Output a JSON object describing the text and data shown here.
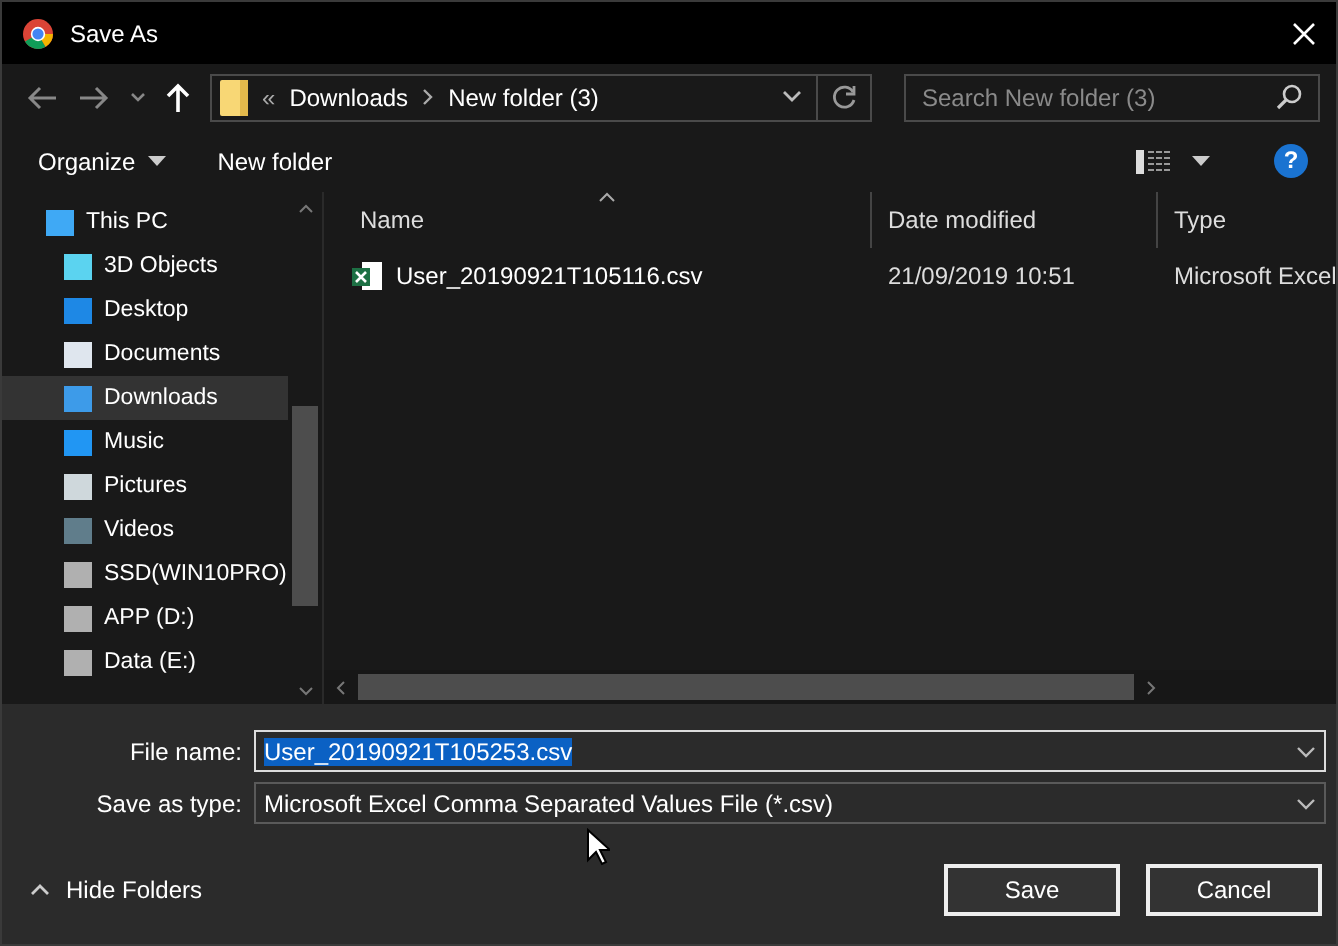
{
  "window": {
    "title": "Save As"
  },
  "address": {
    "overflow": "«",
    "segments": [
      "Downloads",
      "New folder (3)"
    ]
  },
  "search": {
    "placeholder": "Search New folder (3)"
  },
  "toolbar": {
    "organize": "Organize",
    "new_folder": "New folder",
    "help": "?"
  },
  "nav": {
    "items": [
      {
        "label": "This PC",
        "selected": false,
        "children": [
          {
            "label": "3D Objects",
            "selected": false
          },
          {
            "label": "Desktop",
            "selected": false
          },
          {
            "label": "Documents",
            "selected": false
          },
          {
            "label": "Downloads",
            "selected": true
          },
          {
            "label": "Music",
            "selected": false
          },
          {
            "label": "Pictures",
            "selected": false
          },
          {
            "label": "Videos",
            "selected": false
          },
          {
            "label": "SSD(WIN10PRO)",
            "selected": false
          },
          {
            "label": "APP (D:)",
            "selected": false
          },
          {
            "label": "Data (E:)",
            "selected": false
          }
        ]
      }
    ]
  },
  "table": {
    "columns": [
      "Name",
      "Date modified",
      "Type"
    ],
    "rows": [
      {
        "name": "User_20190921T105116.csv",
        "date": "21/09/2019 10:51",
        "type": "Microsoft Excel",
        "selected": false
      }
    ]
  },
  "form": {
    "file_name_label": "File name:",
    "file_name": "User_20190921T105253.csv",
    "type_label": "Save as type:",
    "type_value": "Microsoft Excel Comma Separated Values File (*.csv)"
  },
  "footer": {
    "hide_folders": "Hide Folders",
    "save": "Save",
    "cancel": "Cancel"
  }
}
